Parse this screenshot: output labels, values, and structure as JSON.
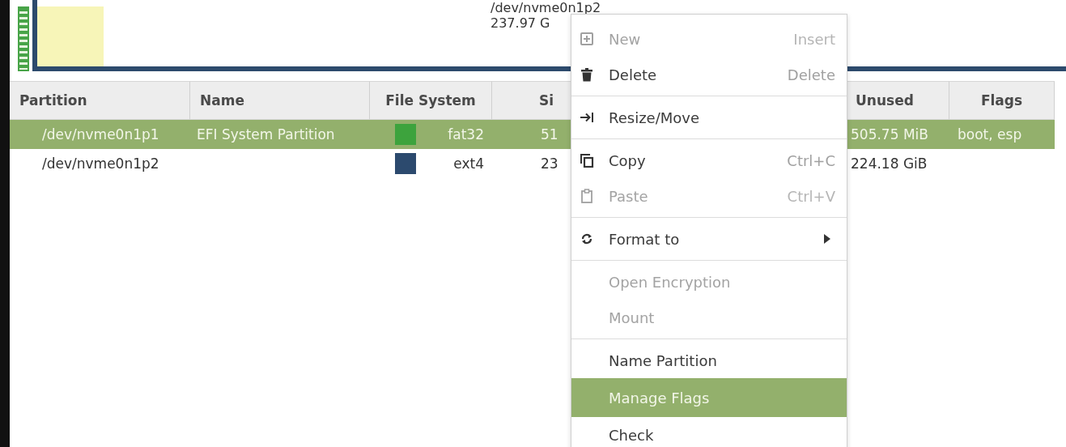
{
  "partition_map": {
    "label_lines": [
      "/dev/nvme0n1p2",
      "237.97 G"
    ]
  },
  "table": {
    "columns": [
      "Partition",
      "Name",
      "File System",
      "Si",
      "Unused",
      "Flags"
    ],
    "rows": [
      {
        "partition": "/dev/nvme0n1p1",
        "name": "EFI System Partition",
        "color": "#3da33d",
        "file_system": "fat32",
        "column_4": "51",
        "unused": "505.75 MiB",
        "flags": "boot, esp",
        "selected": true
      },
      {
        "partition": "/dev/nvme0n1p2",
        "color": "#2c4a6e",
        "file_system": "ext4",
        "column_4": "23",
        "unused": "224.18 GiB",
        "selected": false
      }
    ]
  },
  "context_menu": {
    "items": [
      {
        "kind": "item",
        "label": "New",
        "shortcut": "Insert",
        "disabled": true,
        "selected": false
      },
      {
        "kind": "item",
        "label": "Delete",
        "shortcut": "Delete",
        "disabled": false,
        "selected": false
      },
      {
        "kind": "separator"
      },
      {
        "kind": "item",
        "label": "Resize/Move",
        "disabled": false,
        "selected": false
      },
      {
        "kind": "separator"
      },
      {
        "kind": "item",
        "label": "Copy",
        "shortcut": "Ctrl+C",
        "disabled": false,
        "selected": false
      },
      {
        "kind": "item",
        "label": "Paste",
        "shortcut": "Ctrl+V",
        "disabled": true,
        "selected": false
      },
      {
        "kind": "separator"
      },
      {
        "kind": "item",
        "label": "Format to",
        "submenu": true,
        "disabled": false,
        "selected": false
      },
      {
        "kind": "separator"
      },
      {
        "kind": "item",
        "label": "Open Encryption",
        "disabled": true,
        "selected": false
      },
      {
        "kind": "item",
        "label": "Mount",
        "disabled": true,
        "selected": false
      },
      {
        "kind": "separator"
      },
      {
        "kind": "item",
        "label": "Name Partition",
        "disabled": false,
        "selected": false
      },
      {
        "kind": "item",
        "label": "Manage Flags",
        "disabled": false,
        "selected": true
      },
      {
        "kind": "item",
        "label": "Check",
        "disabled": false,
        "selected": false
      }
    ]
  }
}
